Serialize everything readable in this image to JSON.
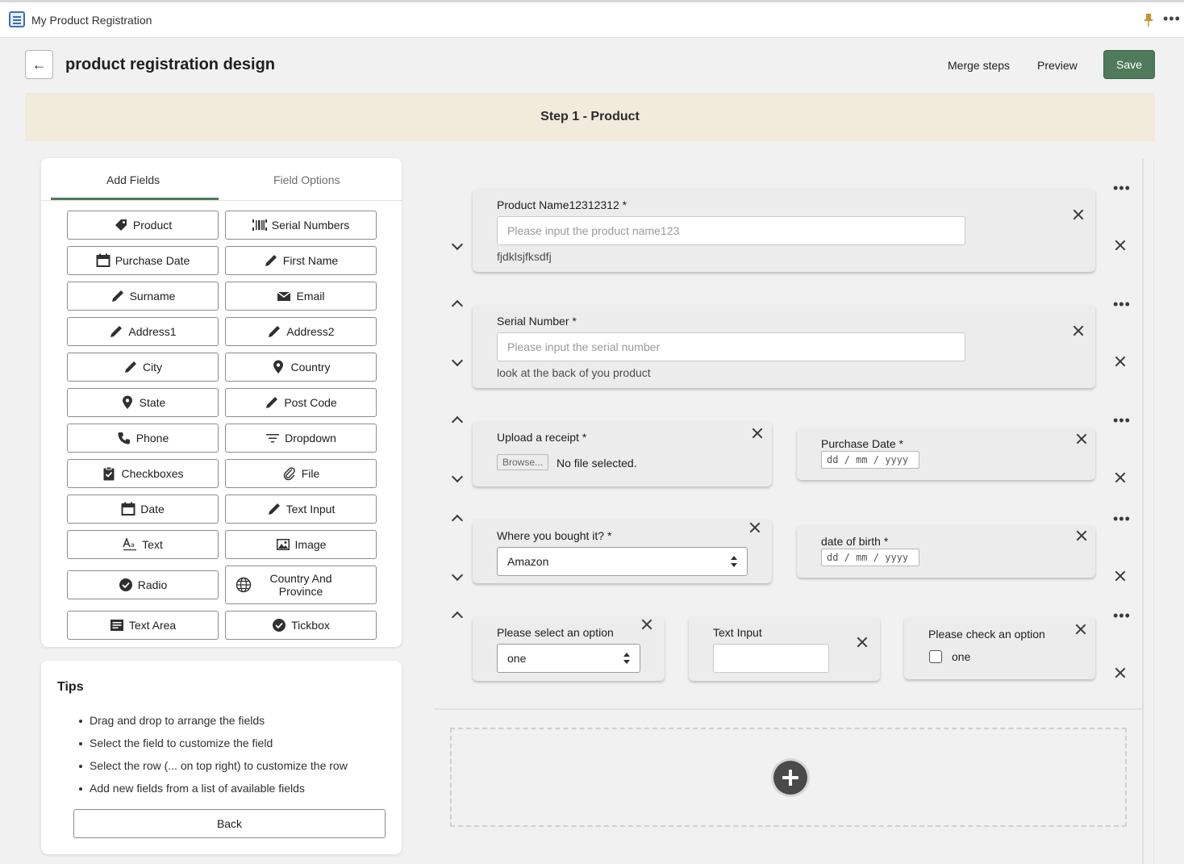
{
  "window": {
    "title": "My Product Registration"
  },
  "header": {
    "title": "product registration design",
    "merge_label": "Merge steps",
    "preview_label": "Preview",
    "save_label": "Save"
  },
  "step": {
    "title": "Step 1 - Product"
  },
  "left_panel": {
    "tabs": [
      {
        "label": "Add Fields",
        "active": true
      },
      {
        "label": "Field Options",
        "active": false
      }
    ],
    "buttons": [
      {
        "label": "Product",
        "icon": "tag-icon"
      },
      {
        "label": "Serial Numbers",
        "icon": "barcode-icon"
      },
      {
        "label": "Purchase Date",
        "icon": "calendar-icon"
      },
      {
        "label": "First Name",
        "icon": "pencil-icon"
      },
      {
        "label": "Surname",
        "icon": "pencil-icon"
      },
      {
        "label": "Email",
        "icon": "envelope-icon"
      },
      {
        "label": "Address1",
        "icon": "pencil-icon"
      },
      {
        "label": "Address2",
        "icon": "pencil-icon"
      },
      {
        "label": "City",
        "icon": "pencil-icon"
      },
      {
        "label": "Country",
        "icon": "location-pin-icon"
      },
      {
        "label": "State",
        "icon": "location-pin-icon"
      },
      {
        "label": "Post Code",
        "icon": "pencil-icon"
      },
      {
        "label": "Phone",
        "icon": "phone-icon"
      },
      {
        "label": "Dropdown",
        "icon": "filter-lines-icon"
      },
      {
        "label": "Checkboxes",
        "icon": "clipboard-check-icon"
      },
      {
        "label": "File",
        "icon": "paperclip-icon"
      },
      {
        "label": "Date",
        "icon": "calendar-icon"
      },
      {
        "label": "Text Input",
        "icon": "pencil-icon"
      },
      {
        "label": "Text",
        "icon": "text-style-icon"
      },
      {
        "label": "Image",
        "icon": "image-icon"
      },
      {
        "label": "Radio",
        "icon": "check-circle-icon"
      },
      {
        "label": "Country And",
        "label2": "Province",
        "icon": "globe-icon"
      },
      {
        "label": "Text Area",
        "icon": "text-area-icon"
      },
      {
        "label": "Tickbox",
        "icon": "check-circle-icon"
      }
    ]
  },
  "tips": {
    "title": "Tips",
    "items": [
      "Drag and drop to arrange the fields",
      "Select the field to customize the field",
      "Select the row (... on top right) to customize the row",
      "Add new fields from a list of available fields"
    ],
    "back_label": "Back"
  },
  "rows": {
    "r1": {
      "label": "Product Name12312312 *",
      "placeholder": "Please input the product name123",
      "help": "fjdklsjfksdfj"
    },
    "r2": {
      "label": "Serial Number *",
      "placeholder": "Please input the serial number",
      "help": "look at the back of you product"
    },
    "r3": {
      "upload": {
        "label": "Upload a receipt *",
        "browse": "Browse...",
        "status": "No file selected."
      },
      "purchase": {
        "label": "Purchase Date *",
        "placeholder": "dd / mm / yyyy"
      }
    },
    "r4": {
      "where": {
        "label": "Where you bought it? *",
        "value": "Amazon"
      },
      "dob": {
        "label": "date of birth *",
        "placeholder": "dd / mm / yyyy"
      }
    },
    "r5": {
      "select": {
        "label": "Please select an option",
        "value": "one"
      },
      "text": {
        "label": "Text Input"
      },
      "check": {
        "label": "Please check an option",
        "option": "one"
      }
    }
  },
  "colors": {
    "accent": "#4f7a5b",
    "banner": "#f2eada"
  }
}
